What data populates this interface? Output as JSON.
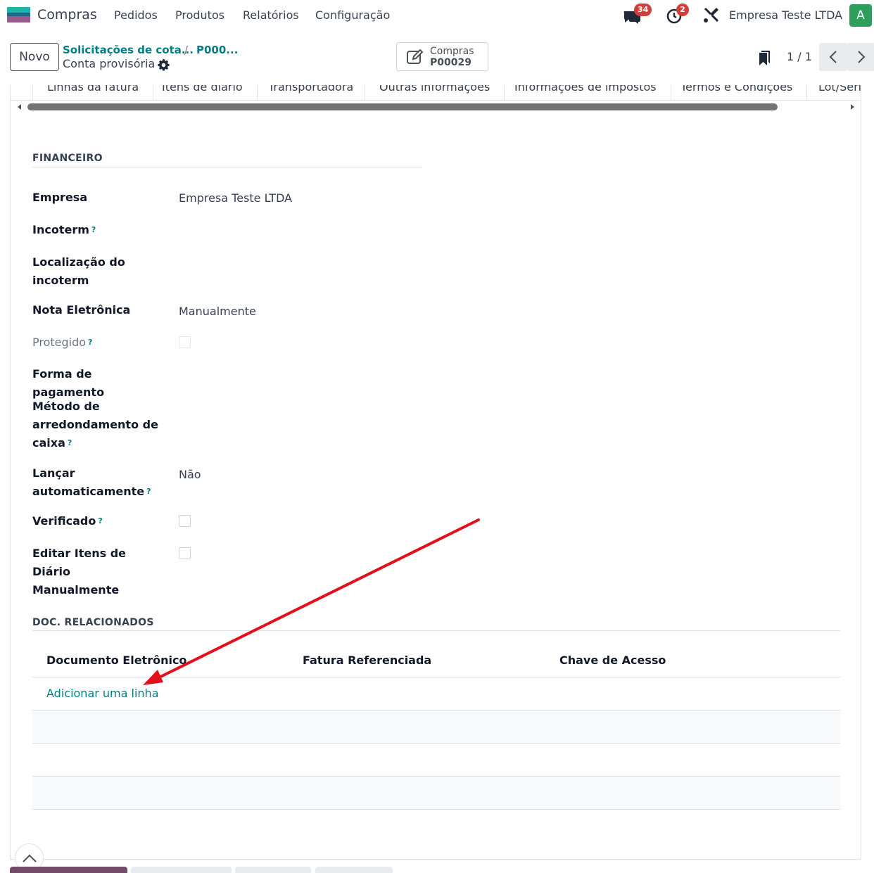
{
  "navbar": {
    "app_name": "Compras",
    "menu": [
      "Pedidos",
      "Produtos",
      "Relatórios",
      "Configuração"
    ],
    "messages_count": "34",
    "activities_count": "2",
    "company": "Empresa Teste LTDA",
    "avatar_letter": "A"
  },
  "control_panel": {
    "new_button": "Novo",
    "breadcrumb": [
      "Solicitações de cota...",
      "P000..."
    ],
    "breadcrumb_separator": "/",
    "current_record": "Conta provisória",
    "smart_button": {
      "label": "Compras",
      "value": "P00029"
    },
    "pager": "1 / 1"
  },
  "tabs": [
    "Linhas da fatura",
    "Itens de diário",
    "Transportadora",
    "Outras informações",
    "Informações de impostos",
    "Termos e Condições",
    "Lot/Seri"
  ],
  "active_tab": "Outras informações",
  "financeiro": {
    "title": "FINANCEIRO",
    "fields": [
      {
        "label": "Empresa",
        "value": "Empresa Teste LTDA"
      },
      {
        "label": "Incoterm",
        "help": "?"
      },
      {
        "label": "Localização do incoterm"
      },
      {
        "label": "Nota Eletrônica",
        "value": "Manualmente"
      },
      {
        "label": "Protegido",
        "help": "?",
        "checked": false
      },
      {
        "label": "Forma de pagamento"
      },
      {
        "label": "Método de arredondamento de caixa",
        "help": "?"
      },
      {
        "label": "Lançar automaticamente",
        "help": "?",
        "value": "Não"
      },
      {
        "label": "Verificado",
        "help": "?",
        "checked": false
      },
      {
        "label": "Editar Itens de Diário Manualmente",
        "checked": false
      }
    ]
  },
  "doc_relacionados": {
    "title": "DOC. RELACIONADOS",
    "columns": [
      "Documento Eletrônico",
      "Fatura Referenciada",
      "Chave de Acesso"
    ],
    "add_line": "Adicionar uma linha"
  },
  "colors": {
    "primary": "#017e84",
    "badge": "#d23f3a",
    "avatar": "#2e9e5b",
    "arrow": "#e3101b"
  }
}
